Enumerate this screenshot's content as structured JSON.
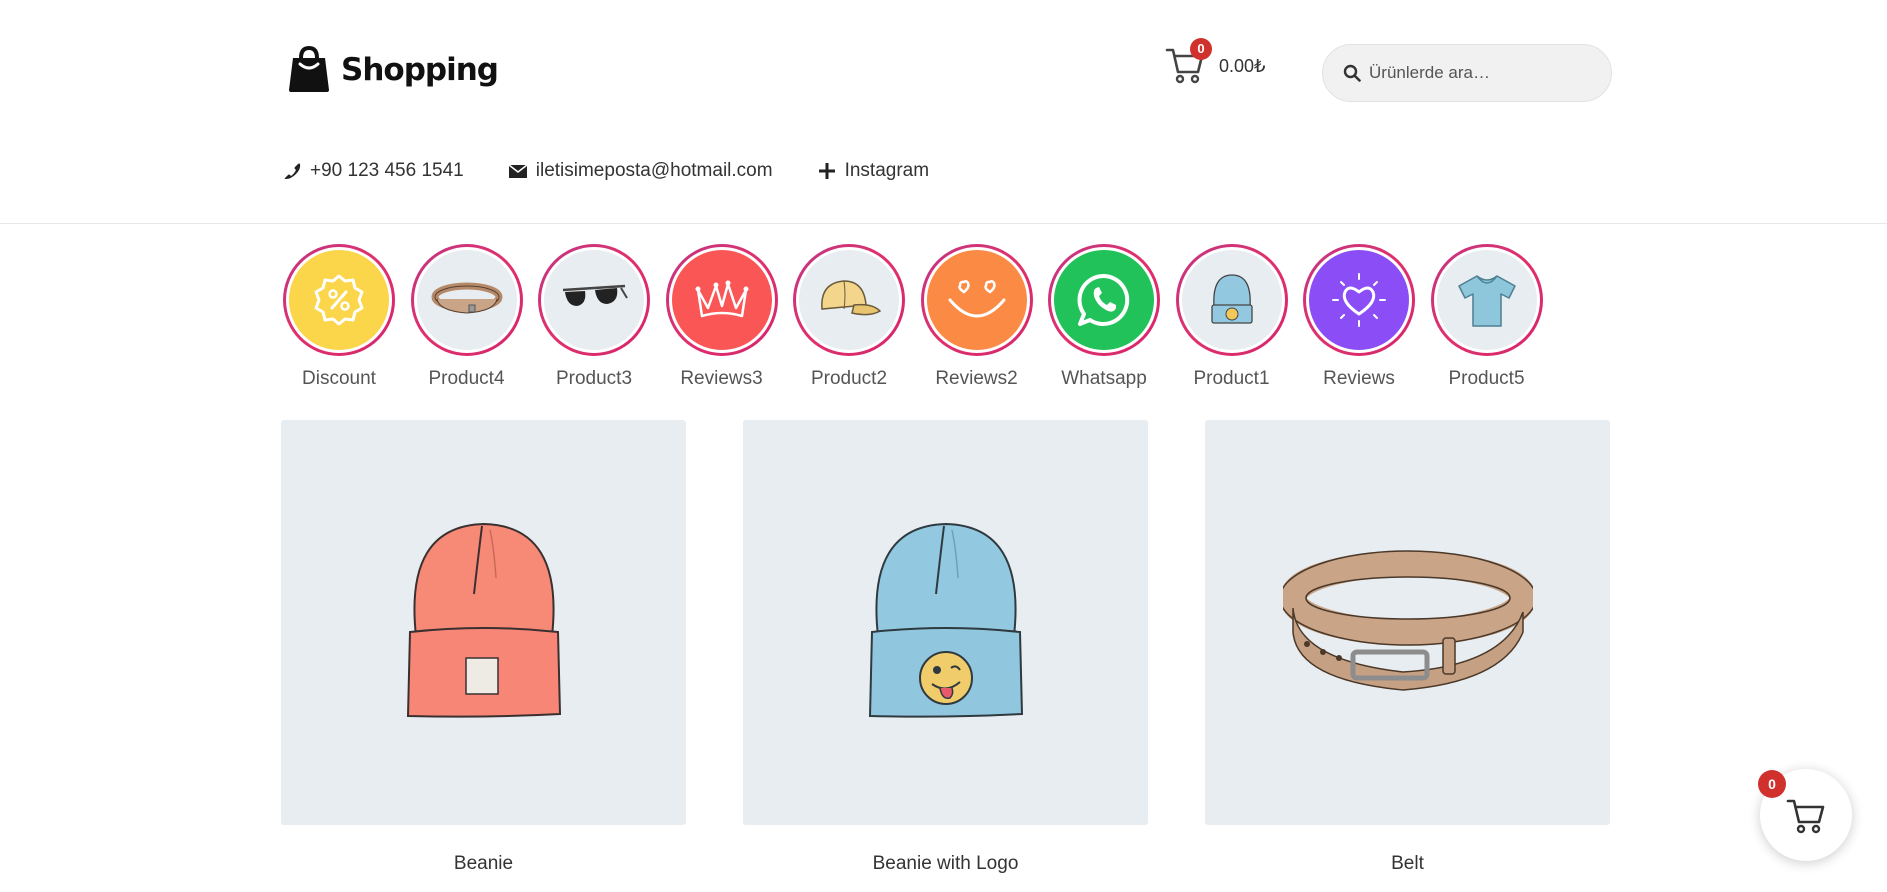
{
  "brand": {
    "name": "Shopping"
  },
  "cart": {
    "count": "0",
    "total": "0.00₺"
  },
  "search": {
    "placeholder": "Ürünlerde ara…"
  },
  "contacts": {
    "phone": "+90 123 456 1541",
    "email": "iletisimeposta@hotmail.com",
    "instagram": "Instagram"
  },
  "stories": [
    {
      "label": "Discount",
      "icon": "discount-badge-icon",
      "color": "#fbd54a"
    },
    {
      "label": "Product4",
      "icon": "belt-icon",
      "color": "#e8edf1"
    },
    {
      "label": "Product3",
      "icon": "sunglasses-icon",
      "color": "#e8edf1"
    },
    {
      "label": "Reviews3",
      "icon": "crown-icon",
      "color": "#fb5656"
    },
    {
      "label": "Product2",
      "icon": "cap-icon",
      "color": "#e8edf1"
    },
    {
      "label": "Reviews2",
      "icon": "smile-icon",
      "color": "#fb8a44"
    },
    {
      "label": "Whatsapp",
      "icon": "whatsapp-icon",
      "color": "#22c25a"
    },
    {
      "label": "Product1",
      "icon": "beanie-icon",
      "color": "#e8edf1"
    },
    {
      "label": "Reviews",
      "icon": "heart-icon",
      "color": "#8b4ef6"
    },
    {
      "label": "Product5",
      "icon": "tshirt-icon",
      "color": "#e8edf1"
    }
  ],
  "products": [
    {
      "name": "Beanie",
      "image": "beanie-image"
    },
    {
      "name": "Beanie with Logo",
      "image": "beanie-with-logo-image"
    },
    {
      "name": "Belt",
      "image": "belt-image"
    }
  ],
  "floating_cart": {
    "count": "0"
  },
  "colors": {
    "badge": "#d0312d",
    "story_ring": "#c13584",
    "product_bg": "#e8edf1"
  }
}
